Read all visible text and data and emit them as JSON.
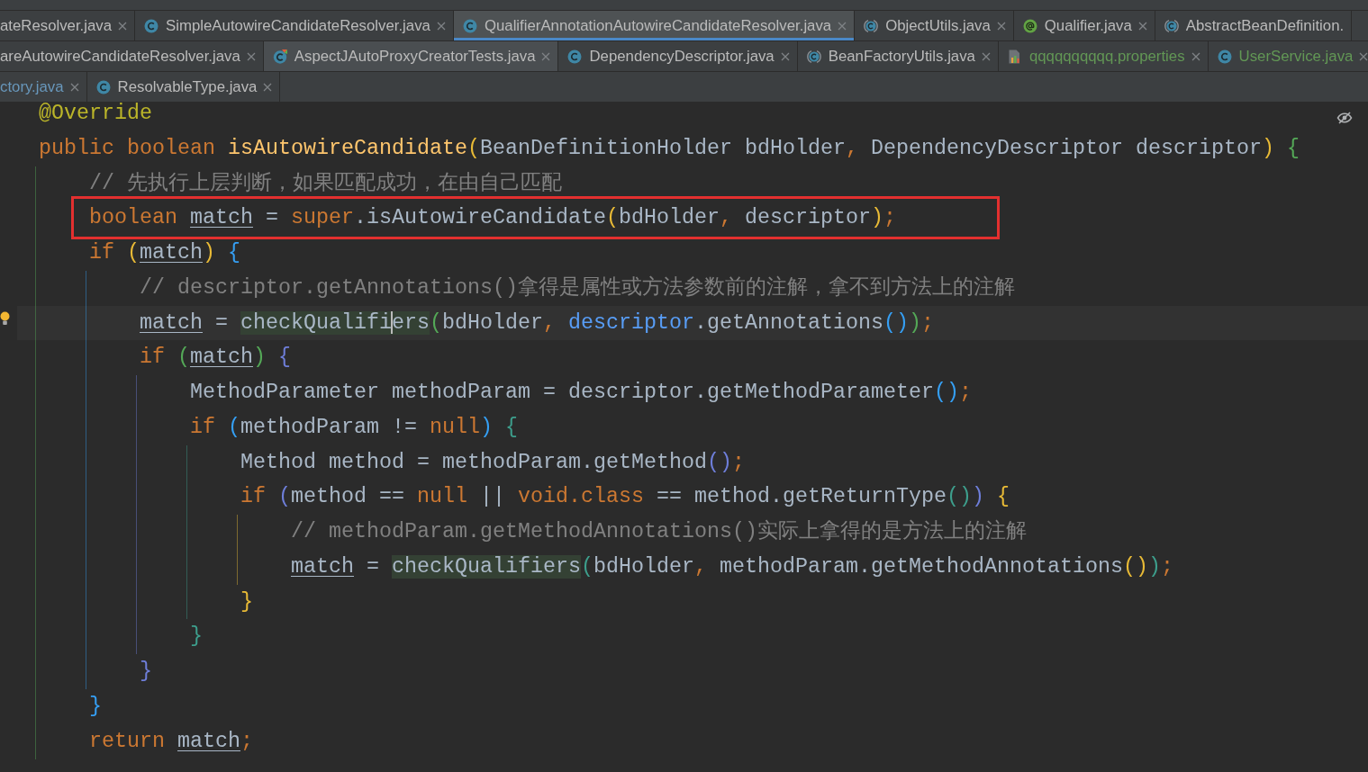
{
  "tab_rows": [
    {
      "tabs": [
        {
          "label": "ateResolver.java",
          "kind": "clipped",
          "modified": false,
          "added": false,
          "selected": false,
          "hovered": false,
          "close_button": true
        },
        {
          "label": "SimpleAutowireCandidateResolver.java",
          "kind": "class",
          "modified": false,
          "added": false,
          "selected": false,
          "hovered": false,
          "close_button": true
        },
        {
          "label": "QualifierAnnotationAutowireCandidateResolver.java",
          "kind": "class",
          "modified": false,
          "added": false,
          "selected": true,
          "hovered": false,
          "close_button": true
        },
        {
          "label": "ObjectUtils.java",
          "kind": "abstract_class",
          "modified": false,
          "added": false,
          "selected": false,
          "hovered": false,
          "close_button": true
        },
        {
          "label": "Qualifier.java",
          "kind": "annotation",
          "modified": false,
          "added": false,
          "selected": false,
          "hovered": false,
          "close_button": true
        },
        {
          "label": "AbstractBeanDefinition.",
          "kind": "abstract_class",
          "modified": false,
          "added": false,
          "selected": false,
          "hovered": false,
          "close_button": false
        }
      ]
    },
    {
      "tabs": [
        {
          "label": "areAutowireCandidateResolver.java",
          "kind": "clipped",
          "modified": false,
          "added": false,
          "selected": false,
          "hovered": false,
          "close_button": true
        },
        {
          "label": "AspectJAutoProxyCreatorTests.java",
          "kind": "test_class",
          "modified": false,
          "added": false,
          "selected": false,
          "hovered": true,
          "close_button": true
        },
        {
          "label": "DependencyDescriptor.java",
          "kind": "class",
          "modified": false,
          "added": false,
          "selected": false,
          "hovered": false,
          "close_button": true
        },
        {
          "label": "BeanFactoryUtils.java",
          "kind": "abstract_class",
          "modified": false,
          "added": false,
          "selected": false,
          "hovered": false,
          "close_button": true
        },
        {
          "label": "qqqqqqqqqq.properties",
          "kind": "properties",
          "modified": false,
          "added": true,
          "selected": false,
          "hovered": false,
          "close_button": true
        },
        {
          "label": "UserService.java",
          "kind": "class",
          "modified": false,
          "added": true,
          "selected": false,
          "hovered": false,
          "close_button": true
        }
      ]
    },
    {
      "tabs": [
        {
          "label": "ctory.java",
          "kind": "clipped",
          "modified": true,
          "added": false,
          "selected": false,
          "hovered": false,
          "close_button": true
        },
        {
          "label": "ResolvableType.java",
          "kind": "class",
          "modified": false,
          "added": false,
          "selected": false,
          "hovered": false,
          "close_button": true
        }
      ]
    }
  ],
  "editor": {
    "lines": [
      {
        "current": false,
        "bulb": false,
        "framed": false,
        "tokens": [
          {
            "kind": "annotation",
            "text": "@Override"
          }
        ]
      },
      {
        "current": false,
        "bulb": false,
        "framed": false,
        "tokens": [
          {
            "kind": "keyword",
            "text": "public "
          },
          {
            "kind": "keyword",
            "text": "boolean "
          },
          {
            "kind": "function",
            "text": "isAutowireCandidate"
          },
          {
            "kind": "bracket",
            "text": "(",
            "color": "#e8ba36"
          },
          {
            "kind": "plain",
            "text": "BeanDefinitionHolder bdHolder"
          },
          {
            "kind": "punctuation",
            "text": ","
          },
          {
            "kind": "plain",
            "text": " DependencyDescriptor descriptor"
          },
          {
            "kind": "bracket",
            "text": ")",
            "color": "#e8ba36"
          },
          {
            "kind": "bracket",
            "text": " {",
            "color": "#54a857"
          }
        ],
        "children": [
          {
            "current": false,
            "bulb": false,
            "framed": false,
            "tokens": [
              {
                "kind": "comment",
                "text": "// 先执行上层判断，如果匹配成功，在由自己匹配"
              }
            ]
          },
          {
            "current": false,
            "bulb": false,
            "framed": true,
            "tokens": [
              {
                "kind": "keyword",
                "text": "boolean "
              },
              {
                "kind": "local",
                "text": "match"
              },
              {
                "kind": "plain",
                "text": " = "
              },
              {
                "kind": "keyword",
                "text": "super"
              },
              {
                "kind": "plain",
                "text": ".isAutowireCandidate"
              },
              {
                "kind": "bracket",
                "text": "(",
                "color": "#e8ba36"
              },
              {
                "kind": "plain",
                "text": "bdHolder"
              },
              {
                "kind": "punctuation",
                "text": ","
              },
              {
                "kind": "plain",
                "text": " descriptor"
              },
              {
                "kind": "bracket",
                "text": ")",
                "color": "#e8ba36"
              },
              {
                "kind": "punctuation",
                "text": ";"
              }
            ]
          },
          {
            "current": false,
            "bulb": false,
            "framed": false,
            "tokens": [
              {
                "kind": "keyword",
                "text": "if "
              },
              {
                "kind": "bracket",
                "text": "(",
                "color": "#e8ba36"
              },
              {
                "kind": "local",
                "text": "match"
              },
              {
                "kind": "bracket",
                "text": ")",
                "color": "#e8ba36"
              },
              {
                "kind": "bracket",
                "text": " {",
                "color": "#359ff4"
              }
            ],
            "children": [
              {
                "current": false,
                "bulb": false,
                "framed": false,
                "tokens": [
                  {
                    "kind": "comment",
                    "text": "// descriptor.getAnnotations()拿得是属性或方法参数前的注解，拿不到方法上的注解"
                  }
                ]
              },
              {
                "current": true,
                "bulb": true,
                "framed": false,
                "tokens": [
                  {
                    "kind": "local",
                    "text": "match"
                  },
                  {
                    "kind": "plain",
                    "text": " = "
                  },
                  {
                    "kind": "usage",
                    "text": "checkQualifi"
                  },
                  {
                    "kind": "caret"
                  },
                  {
                    "kind": "usage",
                    "text": "ers"
                  },
                  {
                    "kind": "bracket",
                    "text": "(",
                    "color": "#54a857"
                  },
                  {
                    "kind": "plain",
                    "text": "bdHolder"
                  },
                  {
                    "kind": "punctuation",
                    "text": ", "
                  },
                  {
                    "kind": "param",
                    "text": "descriptor"
                  },
                  {
                    "kind": "plain",
                    "text": ".getAnnotations"
                  },
                  {
                    "kind": "bracket",
                    "text": "(",
                    "color": "#359ff4"
                  },
                  {
                    "kind": "bracket",
                    "text": ")",
                    "color": "#359ff4"
                  },
                  {
                    "kind": "bracket",
                    "text": ")",
                    "color": "#54a857"
                  },
                  {
                    "kind": "punctuation",
                    "text": ";"
                  }
                ]
              },
              {
                "current": false,
                "bulb": false,
                "framed": false,
                "tokens": [
                  {
                    "kind": "keyword",
                    "text": "if "
                  },
                  {
                    "kind": "bracket",
                    "text": "(",
                    "color": "#54a857"
                  },
                  {
                    "kind": "local",
                    "text": "match"
                  },
                  {
                    "kind": "bracket",
                    "text": ")",
                    "color": "#54a857"
                  },
                  {
                    "kind": "bracket",
                    "text": " {",
                    "color": "#6e7ed9"
                  }
                ],
                "children": [
                  {
                    "current": false,
                    "bulb": false,
                    "framed": false,
                    "tokens": [
                      {
                        "kind": "plain",
                        "text": "MethodParameter methodParam = descriptor.getMethodParameter"
                      },
                      {
                        "kind": "bracket",
                        "text": "(",
                        "color": "#359ff4"
                      },
                      {
                        "kind": "bracket",
                        "text": ")",
                        "color": "#359ff4"
                      },
                      {
                        "kind": "punctuation",
                        "text": ";"
                      }
                    ]
                  },
                  {
                    "current": false,
                    "bulb": false,
                    "framed": false,
                    "tokens": [
                      {
                        "kind": "keyword",
                        "text": "if "
                      },
                      {
                        "kind": "bracket",
                        "text": "(",
                        "color": "#359ff4"
                      },
                      {
                        "kind": "plain",
                        "text": "methodParam != "
                      },
                      {
                        "kind": "keyword",
                        "text": "null"
                      },
                      {
                        "kind": "bracket",
                        "text": ")",
                        "color": "#359ff4"
                      },
                      {
                        "kind": "bracket",
                        "text": " {",
                        "color": "#3d9e8c"
                      }
                    ],
                    "children": [
                      {
                        "current": false,
                        "bulb": false,
                        "framed": false,
                        "tokens": [
                          {
                            "kind": "plain",
                            "text": "Method method = methodParam.getMethod"
                          },
                          {
                            "kind": "bracket",
                            "text": "(",
                            "color": "#6e7ed9"
                          },
                          {
                            "kind": "bracket",
                            "text": ")",
                            "color": "#6e7ed9"
                          },
                          {
                            "kind": "punctuation",
                            "text": ";"
                          }
                        ]
                      },
                      {
                        "current": false,
                        "bulb": false,
                        "framed": false,
                        "tokens": [
                          {
                            "kind": "keyword",
                            "text": "if "
                          },
                          {
                            "kind": "bracket",
                            "text": "(",
                            "color": "#6e7ed9"
                          },
                          {
                            "kind": "plain",
                            "text": "method == "
                          },
                          {
                            "kind": "keyword",
                            "text": "null"
                          },
                          {
                            "kind": "plain",
                            "text": " || "
                          },
                          {
                            "kind": "keyword",
                            "text": "void"
                          },
                          {
                            "kind": "punctuation",
                            "text": "."
                          },
                          {
                            "kind": "keyword",
                            "text": "class"
                          },
                          {
                            "kind": "plain",
                            "text": " == method.getReturnType"
                          },
                          {
                            "kind": "bracket",
                            "text": "(",
                            "color": "#3d9e8c"
                          },
                          {
                            "kind": "bracket",
                            "text": ")",
                            "color": "#3d9e8c"
                          },
                          {
                            "kind": "bracket",
                            "text": ")",
                            "color": "#6e7ed9"
                          },
                          {
                            "kind": "bracket",
                            "text": " {",
                            "color": "#e8ba36"
                          }
                        ],
                        "children": [
                          {
                            "current": false,
                            "bulb": false,
                            "framed": false,
                            "tokens": [
                              {
                                "kind": "comment",
                                "text": "// methodParam.getMethodAnnotations()实际上拿得的是方法上的注解"
                              }
                            ]
                          },
                          {
                            "current": false,
                            "bulb": false,
                            "framed": false,
                            "tokens": [
                              {
                                "kind": "local",
                                "text": "match"
                              },
                              {
                                "kind": "plain",
                                "text": " = "
                              },
                              {
                                "kind": "usage",
                                "text": "checkQualifiers"
                              },
                              {
                                "kind": "bracket",
                                "text": "(",
                                "color": "#3d9e8c"
                              },
                              {
                                "kind": "plain",
                                "text": "bdHolder"
                              },
                              {
                                "kind": "punctuation",
                                "text": ","
                              },
                              {
                                "kind": "plain",
                                "text": " methodParam.getMethodAnnotations"
                              },
                              {
                                "kind": "bracket",
                                "text": "(",
                                "color": "#e8ba36"
                              },
                              {
                                "kind": "bracket",
                                "text": ")",
                                "color": "#e8ba36"
                              },
                              {
                                "kind": "bracket",
                                "text": ")",
                                "color": "#3d9e8c"
                              },
                              {
                                "kind": "punctuation",
                                "text": ";"
                              }
                            ]
                          }
                        ]
                      },
                      {
                        "current": false,
                        "bulb": false,
                        "framed": false,
                        "tokens": [
                          {
                            "kind": "bracket",
                            "text": "}",
                            "color": "#e8ba36"
                          }
                        ]
                      }
                    ]
                  },
                  {
                    "current": false,
                    "bulb": false,
                    "framed": false,
                    "tokens": [
                      {
                        "kind": "bracket",
                        "text": "}",
                        "color": "#3d9e8c"
                      }
                    ]
                  }
                ]
              },
              {
                "current": false,
                "bulb": false,
                "framed": false,
                "tokens": [
                  {
                    "kind": "bracket",
                    "text": "}",
                    "color": "#6e7ed9"
                  }
                ]
              }
            ]
          },
          {
            "current": false,
            "bulb": false,
            "framed": false,
            "tokens": [
              {
                "kind": "bracket",
                "text": "}",
                "color": "#359ff4"
              }
            ]
          },
          {
            "current": false,
            "bulb": false,
            "framed": false,
            "tokens": [
              {
                "kind": "keyword",
                "text": "return "
              },
              {
                "kind": "local",
                "text": "match"
              },
              {
                "kind": "punctuation",
                "text": ";"
              }
            ]
          }
        ]
      }
    ]
  }
}
